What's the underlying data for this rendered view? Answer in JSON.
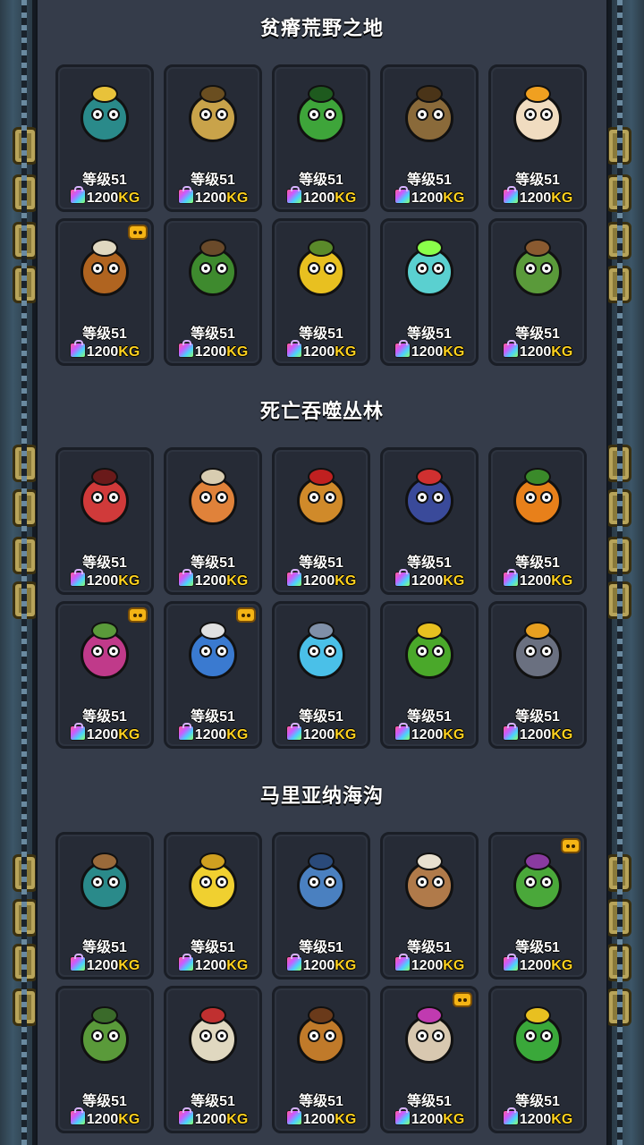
{
  "sections": [
    {
      "title": "贫瘠荒野之地",
      "items": [
        {
          "icon": "two-headed-bird-monster-icon",
          "level": "等级51",
          "amount": "1200",
          "unit": "KG",
          "badge": false,
          "color": "#2a8a8a",
          "accent": "#e8c23a"
        },
        {
          "icon": "wheat-creature-icon",
          "level": "等级51",
          "amount": "1200",
          "unit": "KG",
          "badge": false,
          "color": "#c9a34a",
          "accent": "#6a4e20"
        },
        {
          "icon": "lettuce-creature-icon",
          "level": "等级51",
          "amount": "1200",
          "unit": "KG",
          "badge": false,
          "color": "#3ea53a",
          "accent": "#1e5a1e"
        },
        {
          "icon": "potato-creature-icon",
          "level": "等级51",
          "amount": "1200",
          "unit": "KG",
          "badge": false,
          "color": "#8a6a3a",
          "accent": "#4a3418"
        },
        {
          "icon": "egg-chick-icon",
          "level": "等级51",
          "amount": "1200",
          "unit": "KG",
          "badge": false,
          "color": "#f0dcc0",
          "accent": "#f0a020"
        },
        {
          "icon": "yak-monster-icon",
          "level": "等级51",
          "amount": "1200",
          "unit": "KG",
          "badge": true,
          "color": "#b06420",
          "accent": "#e0d8c0"
        },
        {
          "icon": "broccoli-tree-icon",
          "level": "等级51",
          "amount": "1200",
          "unit": "KG",
          "badge": false,
          "color": "#3e8a2e",
          "accent": "#6a4a2a"
        },
        {
          "icon": "corn-creature-icon",
          "level": "等级51",
          "amount": "1200",
          "unit": "KG",
          "badge": false,
          "color": "#e8c020",
          "accent": "#5a8a2a"
        },
        {
          "icon": "ghost-creature-icon",
          "level": "等级51",
          "amount": "1200",
          "unit": "KG",
          "badge": false,
          "color": "#5ad0d0",
          "accent": "#8aff4a"
        },
        {
          "icon": "cactus-creature-icon",
          "level": "等级51",
          "amount": "1200",
          "unit": "KG",
          "badge": false,
          "color": "#5a9a3a",
          "accent": "#8a5a30"
        }
      ]
    },
    {
      "title": "死亡吞噬丛林",
      "items": [
        {
          "icon": "tomato-toad-icon",
          "level": "等级51",
          "amount": "1200",
          "unit": "KG",
          "badge": false,
          "color": "#d03a3a",
          "accent": "#6a1a1a"
        },
        {
          "icon": "mushroom-llama-icon",
          "level": "等级51",
          "amount": "1200",
          "unit": "KG",
          "badge": false,
          "color": "#e0823a",
          "accent": "#d8ccb0"
        },
        {
          "icon": "mango-monkey-icon",
          "level": "等级51",
          "amount": "1200",
          "unit": "KG",
          "badge": false,
          "color": "#d08a2a",
          "accent": "#c02020"
        },
        {
          "icon": "armored-pig-icon",
          "level": "等级51",
          "amount": "1200",
          "unit": "KG",
          "badge": false,
          "color": "#3a4a9a",
          "accent": "#d03030"
        },
        {
          "icon": "pumpkin-creature-icon",
          "level": "等级51",
          "amount": "1200",
          "unit": "KG",
          "badge": false,
          "color": "#e8801a",
          "accent": "#3a8a2a"
        },
        {
          "icon": "onion-creature-icon",
          "level": "等级51",
          "amount": "1200",
          "unit": "KG",
          "badge": true,
          "color": "#c03a8a",
          "accent": "#5a9a3a"
        },
        {
          "icon": "milk-carton-snail-icon",
          "level": "等级51",
          "amount": "1200",
          "unit": "KG",
          "badge": true,
          "color": "#3a7ad0",
          "accent": "#e0e0e0"
        },
        {
          "icon": "bubble-fish-icon",
          "level": "等级51",
          "amount": "1200",
          "unit": "KG",
          "badge": false,
          "color": "#4ac0e8",
          "accent": "#8090a8"
        },
        {
          "icon": "caterpillar-icon",
          "level": "等级51",
          "amount": "1200",
          "unit": "KG",
          "badge": false,
          "color": "#4aa82a",
          "accent": "#e8c020"
        },
        {
          "icon": "rock-monster-icon",
          "level": "等级51",
          "amount": "1200",
          "unit": "KG",
          "badge": false,
          "color": "#6a7080",
          "accent": "#e8a020"
        }
      ]
    },
    {
      "title": "马里亚纳海沟",
      "items": [
        {
          "icon": "sea-urchin-tree-icon",
          "level": "等级51",
          "amount": "1200",
          "unit": "KG",
          "badge": false,
          "color": "#2a8a8a",
          "accent": "#9a6a3a"
        },
        {
          "icon": "banana-octopus-icon",
          "level": "等级51",
          "amount": "1200",
          "unit": "KG",
          "badge": false,
          "color": "#f0d030",
          "accent": "#d0a020"
        },
        {
          "icon": "blue-crab-icon",
          "level": "等级51",
          "amount": "1200",
          "unit": "KG",
          "badge": false,
          "color": "#4a80c0",
          "accent": "#2a4a7a"
        },
        {
          "icon": "walrus-shell-icon",
          "level": "等级51",
          "amount": "1200",
          "unit": "KG",
          "badge": false,
          "color": "#b07a4a",
          "accent": "#e8e0d0"
        },
        {
          "icon": "mantis-icon",
          "level": "等级51",
          "amount": "1200",
          "unit": "KG",
          "badge": true,
          "color": "#4aa83a",
          "accent": "#8a3aa0"
        },
        {
          "icon": "sea-cucumber-icon",
          "level": "等级51",
          "amount": "1200",
          "unit": "KG",
          "badge": false,
          "color": "#5a9a3a",
          "accent": "#3a6a2a"
        },
        {
          "icon": "clam-creature-icon",
          "level": "等级51",
          "amount": "1200",
          "unit": "KG",
          "badge": false,
          "color": "#e0d8c0",
          "accent": "#c03030"
        },
        {
          "icon": "shrimp-dragon-icon",
          "level": "等级51",
          "amount": "1200",
          "unit": "KG",
          "badge": false,
          "color": "#c07a2a",
          "accent": "#6a3a1a"
        },
        {
          "icon": "oyster-creature-icon",
          "level": "等级51",
          "amount": "1200",
          "unit": "KG",
          "badge": true,
          "color": "#d8c8b0",
          "accent": "#c03ab0"
        },
        {
          "icon": "seahorse-icon",
          "level": "等级51",
          "amount": "1200",
          "unit": "KG",
          "badge": false,
          "color": "#3aa83a",
          "accent": "#e8c020"
        }
      ]
    }
  ]
}
